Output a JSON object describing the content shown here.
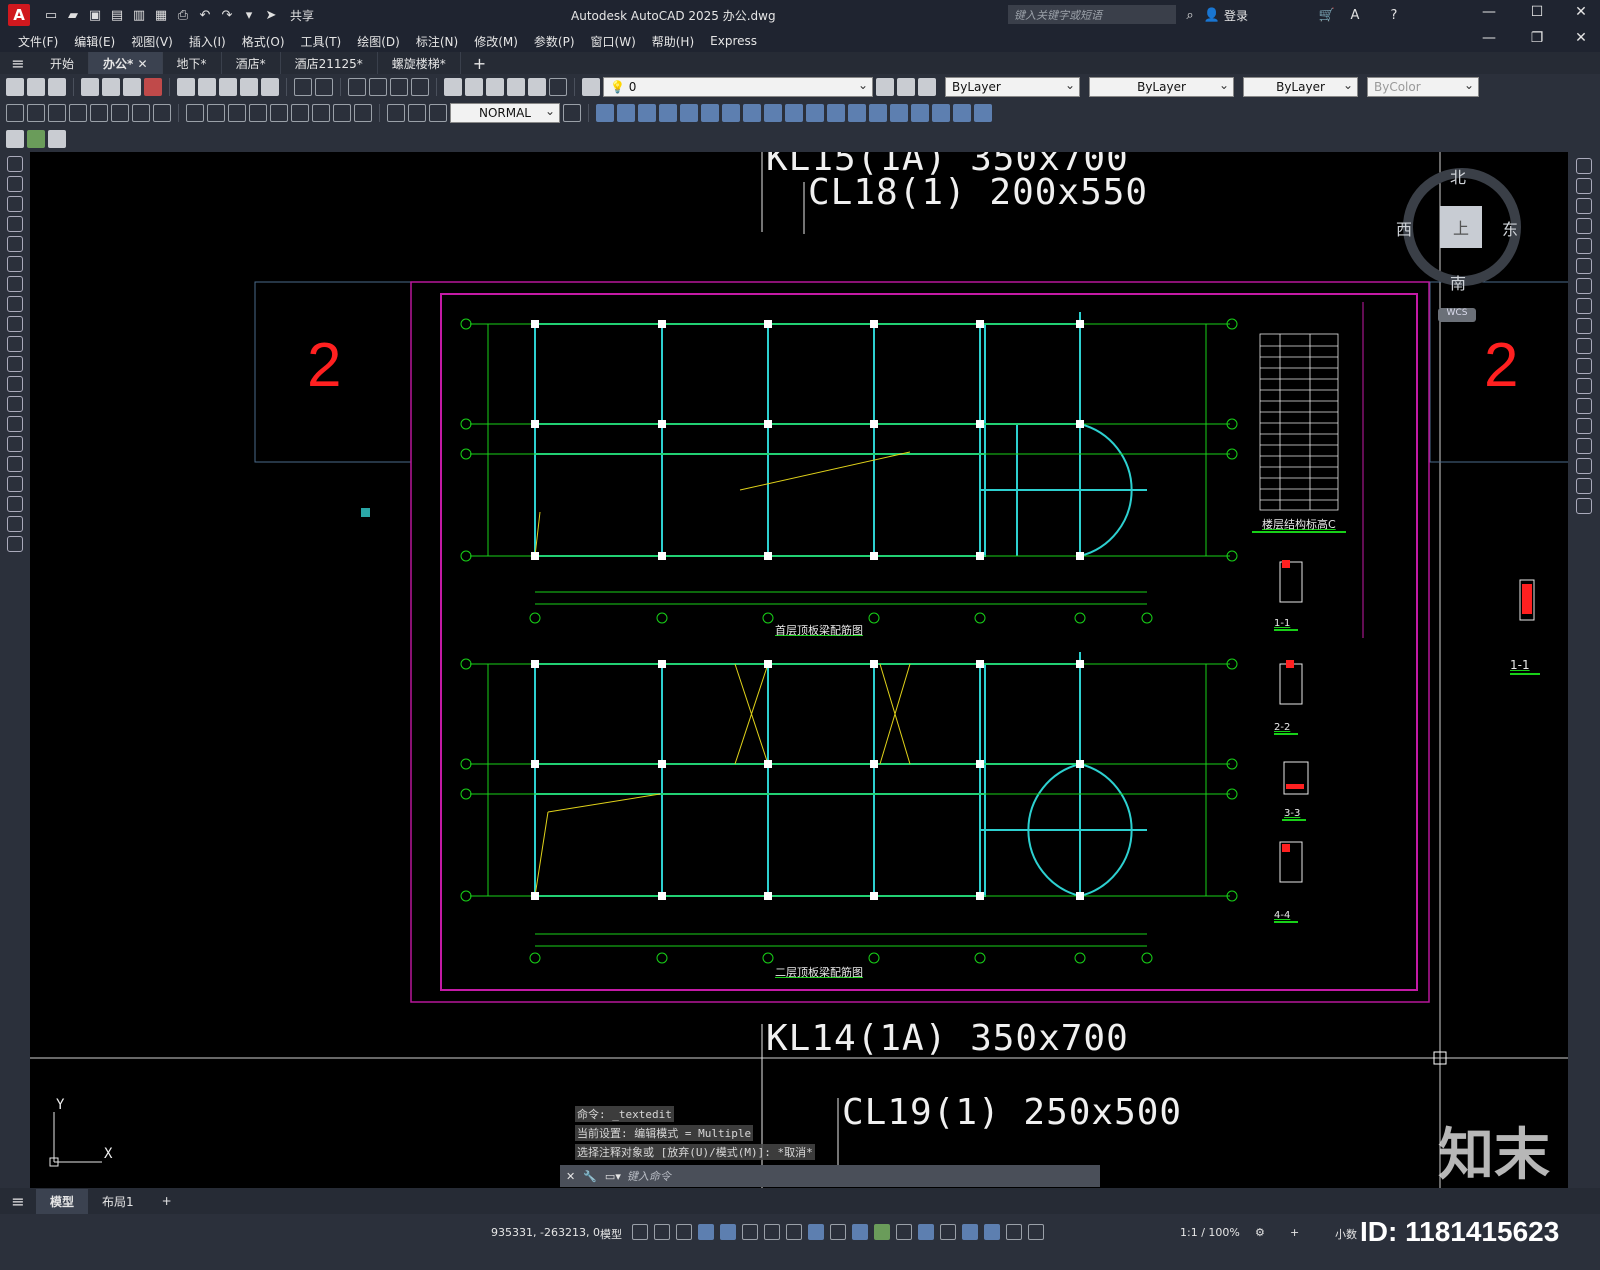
{
  "app": {
    "title": "Autodesk AutoCAD 2025    办公.dwg",
    "logo": "A",
    "share_label": "共享",
    "search_placeholder": "键入关键字或短语",
    "login_label": "登录"
  },
  "menu": [
    "文件(F)",
    "编辑(E)",
    "视图(V)",
    "插入(I)",
    "格式(O)",
    "工具(T)",
    "绘图(D)",
    "标注(N)",
    "修改(M)",
    "参数(P)",
    "窗口(W)",
    "帮助(H)",
    "Express"
  ],
  "file_tabs": [
    {
      "label": "开始",
      "active": false
    },
    {
      "label": "办公*",
      "active": true
    },
    {
      "label": "地下*",
      "active": false
    },
    {
      "label": "酒店*",
      "active": false
    },
    {
      "label": "酒店21125*",
      "active": false
    },
    {
      "label": "螺旋楼梯*",
      "active": false
    }
  ],
  "properties": {
    "layer": "0",
    "text_style": "NORMAL",
    "color": "ByLayer",
    "linetype": "ByLayer",
    "lineweight": "ByLayer",
    "plotstyle": "ByColor"
  },
  "canvas": {
    "label_top_1": "KL15(1A) 350x700",
    "label_top_2": "CL18(1) 200x550",
    "label_bottom_1": "KL14(1A) 350x700",
    "label_bottom_2": "CL19(1) 250x500",
    "marker_left": "2",
    "marker_right": "2",
    "plan1_title": "首层顶板梁配筋图",
    "plan2_title": "二层顶板梁配筋图",
    "elev_table_title": "楼层结构标高C",
    "sections": [
      "1-1",
      "2-2",
      "3-3",
      "4-4"
    ],
    "right_section": "1-1"
  },
  "viewcube": {
    "north": "北",
    "south": "南",
    "east": "东",
    "west": "西",
    "top": "上",
    "wcs": "WCS"
  },
  "ucs": {
    "x": "X",
    "y": "Y"
  },
  "command": {
    "history": [
      "命令: _textedit",
      "当前设置: 编辑模式 = Multiple",
      "选择注释对象或 [放弃(U)/模式(M)]: *取消*"
    ],
    "placeholder": "键入命令"
  },
  "layout_tabs": [
    {
      "label": "模型",
      "active": true
    },
    {
      "label": "布局1",
      "active": false
    }
  ],
  "status": {
    "coords": "935331, -263213, 0",
    "mode": "模型",
    "scale": "1:1 / 100%",
    "units": "小数"
  },
  "watermark": {
    "brand": "知末",
    "id": "ID: 1181415623"
  }
}
